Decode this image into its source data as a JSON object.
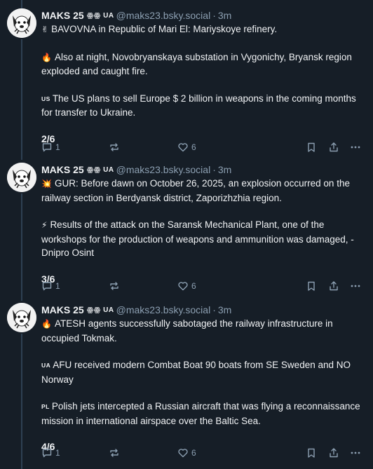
{
  "posts": [
    {
      "author": "MAKS 25",
      "badge": "ꙮꙮ UA",
      "handle": "@maks23.bsky.social",
      "separator": "·",
      "time": "3m",
      "paragraphs": [
        {
          "emoji": "✌",
          "flag": "",
          "text": "BAVOVNA in Republic of Mari El: Mariyskoye refinery."
        },
        {
          "emoji": "🔥",
          "flag": "",
          "text": "Also at night, Novobryanskaya substation in Vygonichy, Bryansk region exploded and caught fire."
        },
        {
          "emoji": "",
          "flag": "US",
          "text": "The US plans to sell Europe $ 2 billion in weapons in the coming months for transfer to Ukraine."
        }
      ],
      "counter": "2/6",
      "replies": "1",
      "reposts": "",
      "likes": "6"
    },
    {
      "author": "MAKS 25",
      "badge": "ꙮꙮ UA",
      "handle": "@maks23.bsky.social",
      "separator": "·",
      "time": "3m",
      "paragraphs": [
        {
          "emoji": "💥",
          "flag": "",
          "text": "GUR: Before dawn on October 26, 2025, an explosion occurred on the railway section in Berdyansk district, Zaporizhzhia region."
        },
        {
          "emoji": "⚡",
          "flag": "",
          "text": "Results of the attack on the Saransk Mechanical Plant, one of the workshops for the production of weapons and ammunition was damaged, - Dnipro Osint"
        }
      ],
      "counter": "3/6",
      "replies": "1",
      "reposts": "",
      "likes": "6"
    },
    {
      "author": "MAKS 25",
      "badge": "ꙮꙮ UA",
      "handle": "@maks23.bsky.social",
      "separator": "·",
      "time": "3m",
      "paragraphs": [
        {
          "emoji": "🔥",
          "flag": "",
          "text": "ATESH agents successfully sabotaged the railway infrastructure in occupied Tokmak."
        },
        {
          "emoji": "",
          "flag": "UA",
          "text": "AFU received modern Combat Boat 90 boats from SE Sweden and NO Norway"
        },
        {
          "emoji": "",
          "flag": "PL",
          "text": "Polish jets intercepted a Russian aircraft that was flying a reconnaissance mission in international airspace over the Baltic Sea."
        }
      ],
      "counter": "4/6",
      "replies": "1",
      "reposts": "",
      "likes": "6"
    }
  ],
  "colors": {
    "background": "#161e27",
    "text": "#f1f3f5",
    "muted": "#8c9fb1",
    "thread_line": "#2e4052"
  },
  "icons": {
    "reply": "reply-icon",
    "repost": "repost-icon",
    "like": "heart-icon",
    "bookmark": "bookmark-icon",
    "share": "share-icon",
    "more": "more-icon"
  }
}
